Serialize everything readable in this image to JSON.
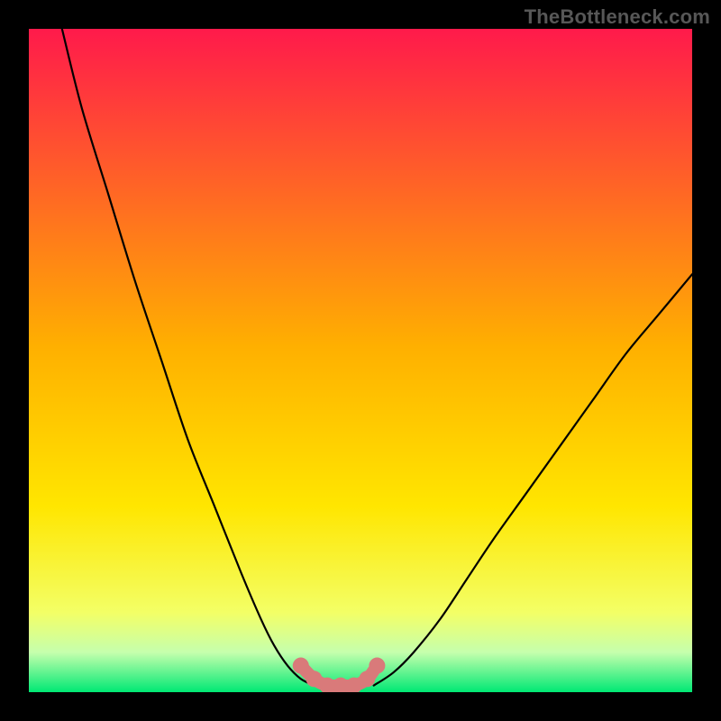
{
  "watermark": "TheBottleneck.com",
  "chart_data": {
    "type": "line",
    "title": "",
    "xlabel": "",
    "ylabel": "",
    "xlim": [
      0,
      100
    ],
    "ylim": [
      0,
      100
    ],
    "grid": false,
    "series": [
      {
        "name": "left-curve",
        "x": [
          5,
          8,
          12,
          16,
          20,
          24,
          28,
          32,
          35,
          37,
          39,
          41,
          43
        ],
        "y": [
          100,
          88,
          75,
          62,
          50,
          38,
          28,
          18,
          11,
          7,
          4,
          2,
          1
        ]
      },
      {
        "name": "right-curve",
        "x": [
          52,
          55,
          58,
          62,
          66,
          70,
          75,
          80,
          85,
          90,
          95,
          100
        ],
        "y": [
          1,
          3,
          6,
          11,
          17,
          23,
          30,
          37,
          44,
          51,
          57,
          63
        ]
      },
      {
        "name": "valley-highlight",
        "x": [
          41,
          43,
          45,
          47,
          49,
          51,
          52.5
        ],
        "y": [
          4,
          2,
          1,
          1,
          1,
          2,
          4
        ]
      }
    ],
    "background_gradient": {
      "top": "#ff1a4b",
      "mid": "#ffd400",
      "bottom": "#00e874"
    },
    "highlight_color": "#d97a7a",
    "curve_color": "#000000"
  }
}
